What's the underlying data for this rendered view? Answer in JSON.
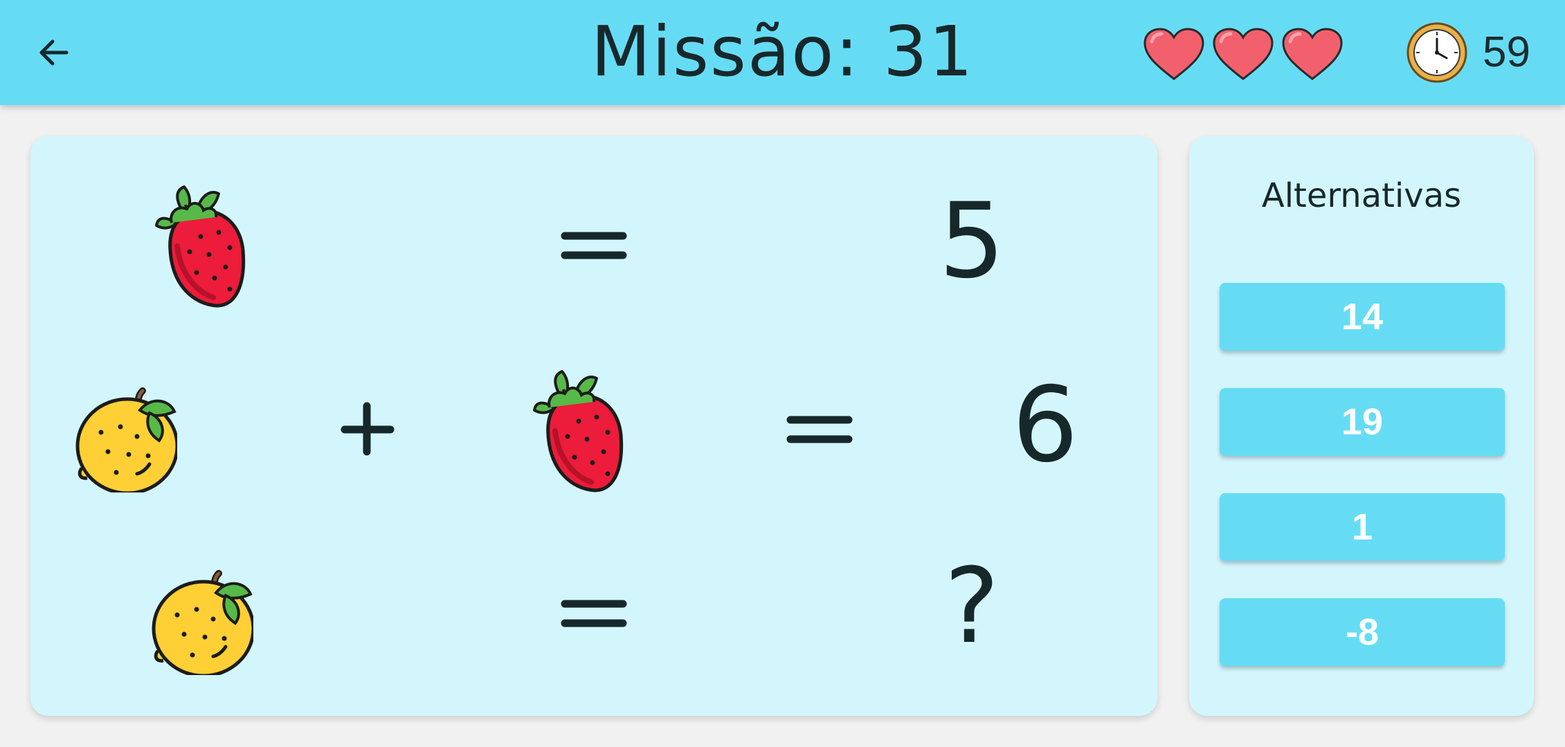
{
  "header": {
    "title": "Missão: 31",
    "back_icon": "arrow-left-icon",
    "lives": 3,
    "heart_color": "#f2606e",
    "timer_icon": "clock-icon",
    "timer_value": "59",
    "background_color": "#66dcf4"
  },
  "puzzle": {
    "rows": [
      {
        "left": "strawberry",
        "operator": null,
        "right": null,
        "equals": "=",
        "result": "5"
      },
      {
        "left": "lemon",
        "operator": "+",
        "right": "strawberry",
        "equals": "=",
        "result": "6"
      },
      {
        "left": "lemon",
        "operator": null,
        "right": null,
        "equals": "=",
        "result": "?"
      }
    ]
  },
  "answers": {
    "title": "Alternativas",
    "options": [
      "14",
      "19",
      "1",
      "-8"
    ]
  }
}
